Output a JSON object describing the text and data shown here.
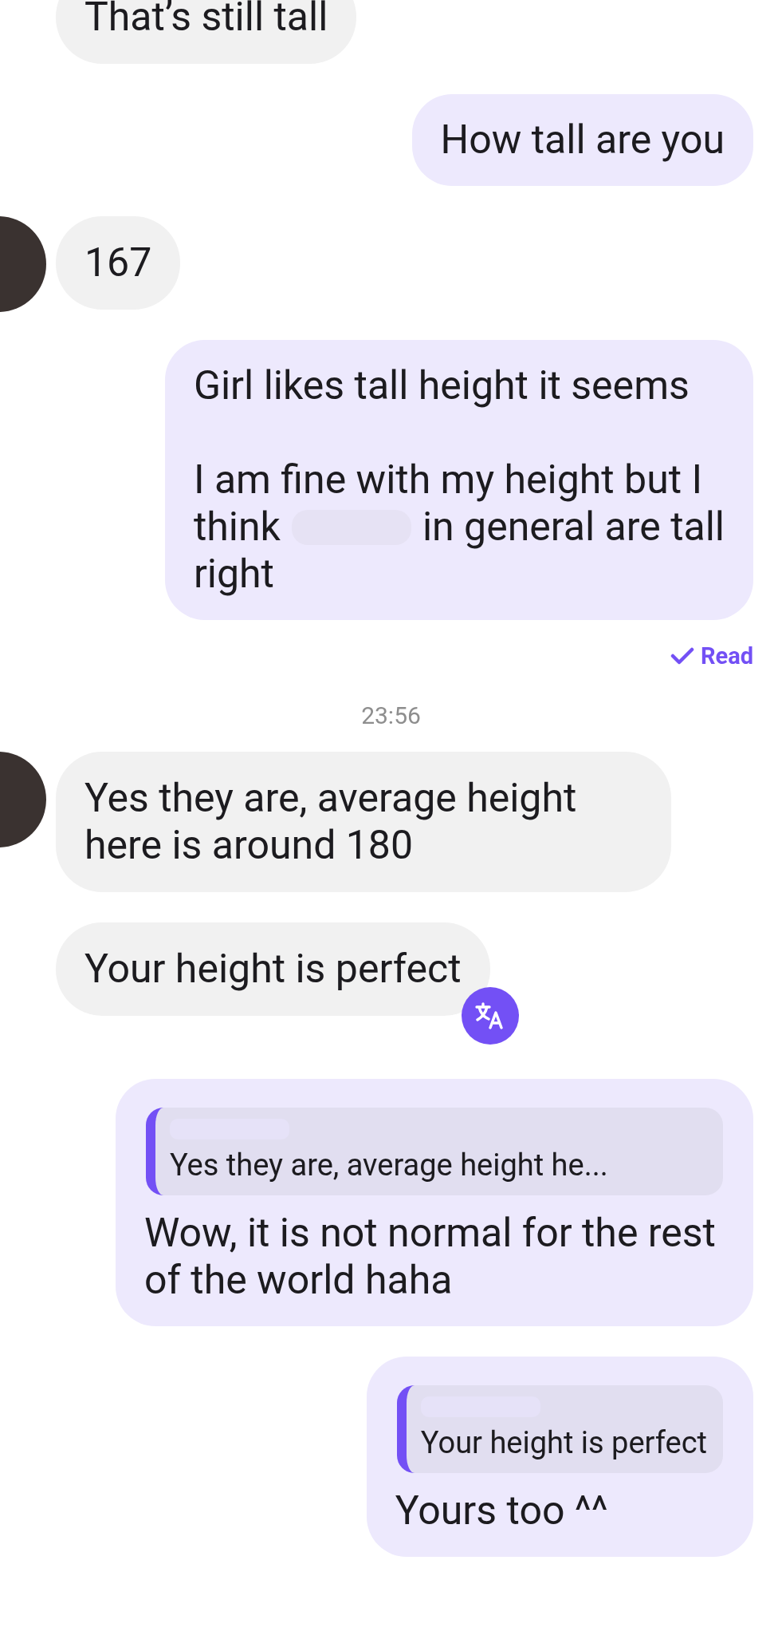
{
  "messages": [
    {
      "kind": "incoming",
      "avatar": false,
      "text": "That’s still tall",
      "translate": false
    },
    {
      "kind": "outgoing",
      "segments": [
        {
          "kind": "text",
          "text": "How tall are you"
        }
      ]
    },
    {
      "kind": "incoming",
      "avatar": true,
      "text": "167",
      "translate": false
    },
    {
      "kind": "outgoing",
      "segments": [
        {
          "kind": "text",
          "text": "Girl likes tall height it seems\n\nI am fine with my height but I"
        },
        {
          "kind": "line",
          "parts": [
            {
              "kind": "text",
              "text": "think"
            },
            {
              "kind": "redaction"
            },
            {
              "kind": "text",
              "text": "in general are tall"
            }
          ]
        },
        {
          "kind": "text",
          "text": "right"
        }
      ]
    },
    {
      "kind": "receipt",
      "text": "Read"
    },
    {
      "kind": "timestamp",
      "text": "23:56"
    },
    {
      "kind": "incoming",
      "avatar": true,
      "text": "Yes they are, average height here is around 180",
      "translate": false
    },
    {
      "kind": "incoming",
      "avatar": false,
      "text": "Your height is perfect",
      "translate": true
    },
    {
      "kind": "outgoing",
      "quote": "Yes they are, average height he...",
      "segments": [
        {
          "kind": "text",
          "text": "Wow, it is not normal for the rest of the world haha"
        }
      ]
    },
    {
      "kind": "outgoing",
      "quote": "Your height is perfect",
      "segments": [
        {
          "kind": "text",
          "text": "Yours too ^^"
        }
      ]
    }
  ]
}
